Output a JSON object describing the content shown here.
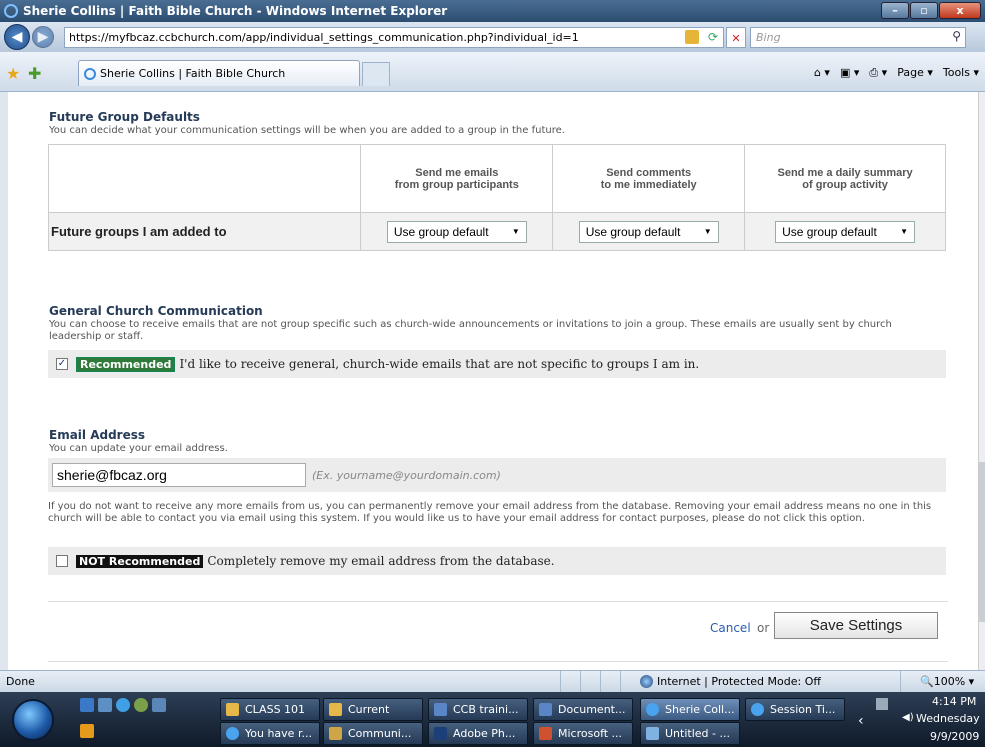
{
  "window": {
    "title": "Sherie Collins | Faith Bible Church - Windows Internet Explorer",
    "min_label": "–",
    "max_label": "▫",
    "close_label": "x"
  },
  "address_bar": {
    "url": "https://myfbcaz.ccbchurch.com/app/individual_settings_communication.php?individual_id=1",
    "search_placeholder": "Bing"
  },
  "tab": {
    "title": "Sherie Collins | Faith Bible Church"
  },
  "command_bar": {
    "page": "Page ▾",
    "tools": "Tools ▾"
  },
  "future_groups": {
    "title": "Future Group Defaults",
    "description": "You can decide what your communication settings will be when you are added to a group in the future.",
    "columns": [
      {
        "line1": "Send me emails",
        "line2": "from group participants"
      },
      {
        "line1": "Send comments",
        "line2": "to me immediately"
      },
      {
        "line1": "Send me a daily summary",
        "line2": "of group activity"
      }
    ],
    "row_label": "Future groups I am added to",
    "selects": [
      "Use group default",
      "Use group default",
      "Use group default"
    ]
  },
  "general": {
    "title": "General Church Communication",
    "description": "You can choose to receive emails that are not group specific such as church-wide announcements or invitations to join a group. These emails are usually sent by church leadership or staff.",
    "checked_mark": "✓",
    "tag": "Recommended",
    "option_text": "I'd like to receive general, church-wide emails that are not specific to groups I am in."
  },
  "email": {
    "title": "Email Address",
    "description": "You can update your email address.",
    "value": "sherie@fbcaz.org",
    "hint": "(Ex. yourname@yourdomain.com)",
    "warning": "If you do not want to receive any more emails from us, you can permanently remove your email address from the database. Removing your email address means no one in this church will be able to contact you via email using this system. If you would like us to have your email address for contact purposes, please do not click this option.",
    "remove_tag": "NOT Recommended",
    "remove_text": "Completely remove my email address from the database."
  },
  "actions": {
    "cancel": "Cancel",
    "or": "or",
    "save": "Save Settings"
  },
  "status": {
    "left": "Done",
    "zone": "Internet | Protected Mode: Off",
    "zoom": "100%"
  },
  "taskbar": {
    "buttons_top": [
      "CLASS 101",
      "Current",
      "CCB traini...",
      "Document...",
      "Sherie Coll...",
      "Session Ti..."
    ],
    "buttons_bottom": [
      "You have r...",
      "Communi...",
      "Adobe Ph...",
      "Microsoft ...",
      "Untitled - ..."
    ],
    "time": "4:14 PM",
    "day": "Wednesday",
    "date": "9/9/2009"
  }
}
